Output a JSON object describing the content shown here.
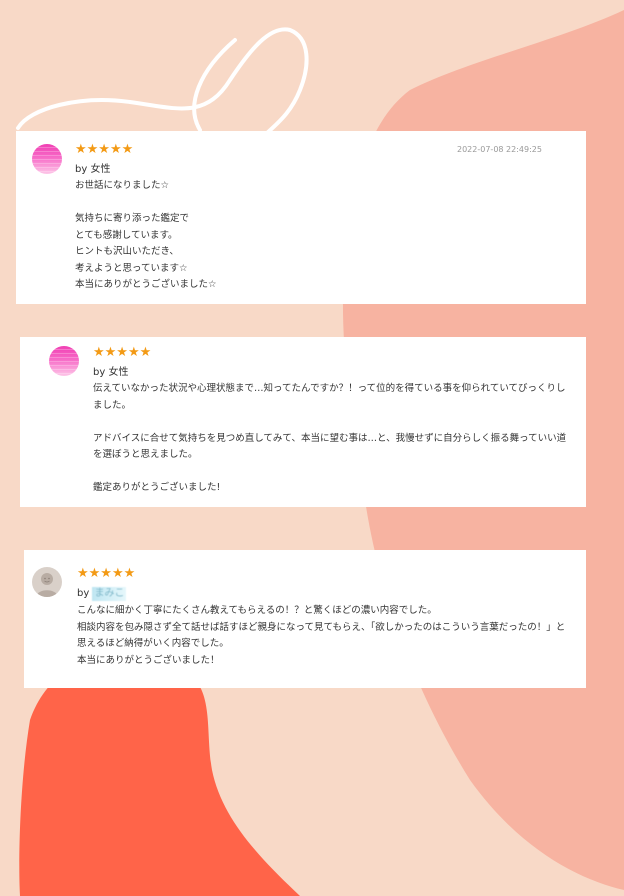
{
  "colors": {
    "background": "#f8d9c7",
    "blob_salmon": "#f7b3a1",
    "blob_coral": "#ff6449",
    "star": "#f39a15"
  },
  "reviews": [
    {
      "avatar_icon": "pink-avatar-icon",
      "stars": "★★★★★",
      "date": "2022-07-08 22:49:25",
      "by_prefix": "by",
      "author": "女性",
      "text": "お世話になりました☆\n\n気持ちに寄り添った鑑定で\nとても感謝しています。\nヒントも沢山いただき、\n考えようと思っています☆\n本当にありがとうございました☆"
    },
    {
      "avatar_icon": "pink-avatar-icon",
      "stars": "★★★★★",
      "by_prefix": "by",
      "author": "女性",
      "text": "伝えていなかった状況や心理状態まで…知ってたんですか？！って位的を得ている事を仰られていてびっくりしました。\n\nアドバイスに合せて気持ちを見つめ直してみて、本当に望む事は…と、我慢せずに自分らしく振る舞っていい道を選ぼうと思えました。\n\n鑑定ありがとうございました!"
    },
    {
      "avatar_icon": "default-user-avatar-icon",
      "stars": "★★★★★",
      "by_prefix": "by",
      "author": "まみこ",
      "text": "こんなに細かく丁寧にたくさん教えてもらえるの！？と驚くほどの濃い内容でした。\n相談内容を包み隠さず全て話せば話すほど親身になって見てもらえ、「欲しかったのはこういう言葉だったの！」と思えるほど納得がいく内容でした。\n本当にありがとうございました！"
    }
  ]
}
